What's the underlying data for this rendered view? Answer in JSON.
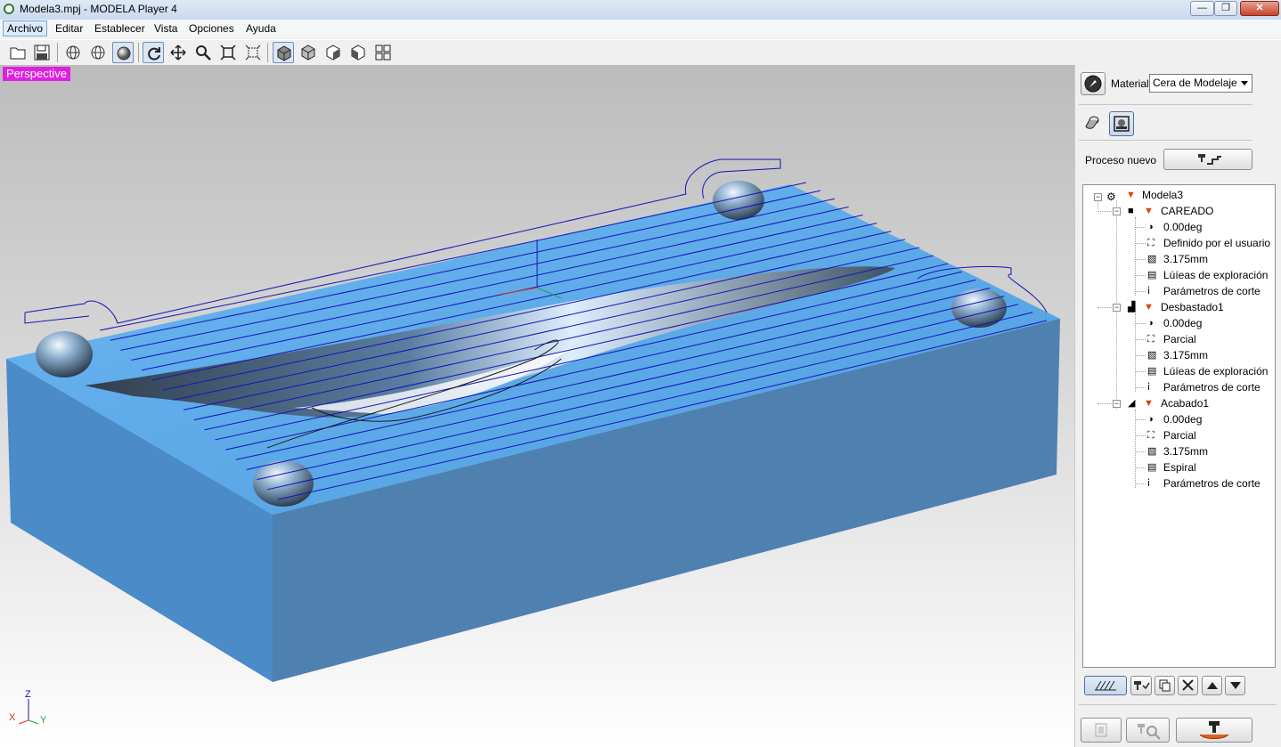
{
  "window": {
    "title": "Modela3.mpj - MODELA Player 4"
  },
  "menu": [
    "Archivo",
    "Editar",
    "Establecer",
    "Vista",
    "Opciones",
    "Ayuda"
  ],
  "toolbar": {
    "buttons": [
      "open-file",
      "save",
      "wireframe-view",
      "hidden-line-view",
      "shaded-view",
      "rotate",
      "pan",
      "zoom",
      "fit",
      "zoom-window",
      "view-iso",
      "view-front",
      "view-right",
      "view-top",
      "view-multi"
    ]
  },
  "viewport": {
    "view_label": "Perspective",
    "axes": {
      "z": "Z",
      "x": "X",
      "y": "Y"
    }
  },
  "panel": {
    "material_label": "Material",
    "material_value": "Cera de Modelaje",
    "new_process_label": "Proceso nuevo"
  },
  "tree": {
    "root": "Modela3",
    "processes": [
      {
        "name": "CAREADO",
        "items": [
          "0.00deg",
          "Definido por el usuario",
          "3.175mm",
          "Lúíeas de exploración",
          "Parámetros de corte"
        ]
      },
      {
        "name": "Desbastado1",
        "items": [
          "0.00deg",
          "Parcial",
          "3.175mm",
          "Lúíeas de exploración",
          "Parámetros de corte"
        ]
      },
      {
        "name": "Acabado1",
        "items": [
          "0.00deg",
          "Parcial",
          "3.175mm",
          "Espiral",
          "Parámetros de corte"
        ]
      }
    ]
  },
  "colors": {
    "model_top": "#5aa7e6",
    "model_side": "#4f86b9",
    "toolpath": "#1414b4",
    "view_label_bg": "#e020e0"
  }
}
